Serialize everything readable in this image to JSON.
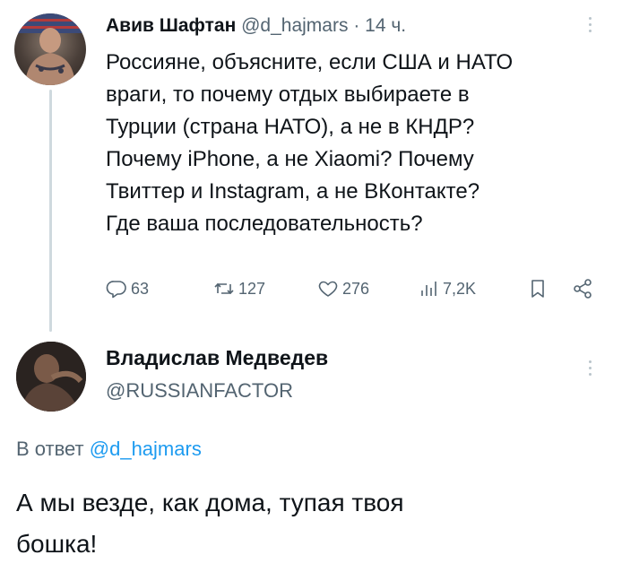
{
  "tweet": {
    "author_name": "Авив Шафтан",
    "author_handle": "@d_hajmars",
    "separator": "·",
    "time": "14 ч.",
    "text_lines": [
      "Россияне, объясните, если США и НАТО",
      "враги, то почему отдых выбираете в",
      "Турции (страна НАТО), а не в КНДР?",
      "Почему iPhone, а не Xiaomi? Почему",
      "Твиттер  и Instagram, а не ВКонтакте?",
      "Где ваша последовательность?"
    ],
    "actions": {
      "replies": "63",
      "retweets": "127",
      "likes": "276",
      "views": "7,2K"
    },
    "icons": [
      "reply-icon",
      "retweet-icon",
      "like-icon",
      "views-icon",
      "bookmark-icon",
      "share-icon",
      "more-icon"
    ]
  },
  "reply": {
    "author_name": "Владислав Медведев",
    "author_handle": "@RUSSIANFACTOR",
    "reply_prefix": "В ответ",
    "reply_to_handle": "@d_hajmars",
    "text_lines": [
      "А мы везде, как дома, тупая твоя",
      "бошка!"
    ]
  },
  "colors": {
    "text": "#0f1419",
    "secondary": "#536471",
    "link": "#1d9bf0",
    "thread_line": "#cfd9de"
  }
}
